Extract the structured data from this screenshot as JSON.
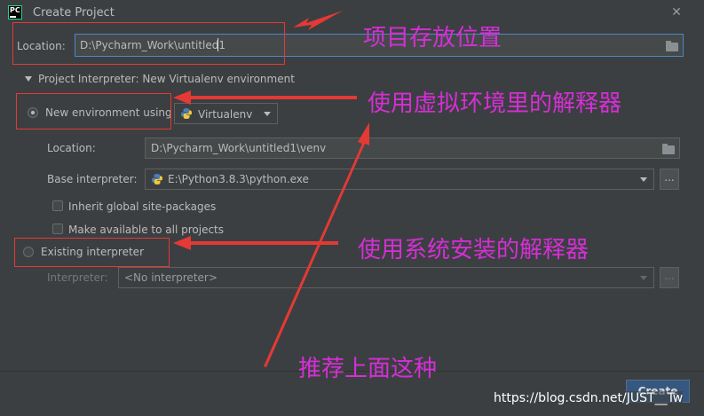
{
  "window": {
    "title": "Create Project"
  },
  "location": {
    "label": "Location:",
    "value": "D:\\Pycharm_Work\\untitled1"
  },
  "section": {
    "title": "Project Interpreter: New Virtualenv environment"
  },
  "new_env": {
    "radio_label": "New environment using",
    "tool": "Virtualenv",
    "location_label": "Location:",
    "location_value": "D:\\Pycharm_Work\\untitled1\\venv",
    "base_label": "Base interpreter:",
    "base_value": "E:\\Python3.8.3\\python.exe",
    "browse_label": "...",
    "inherit_label": "Inherit global site-packages",
    "make_available_label": "Make available to all projects"
  },
  "existing": {
    "radio_label": "Existing interpreter",
    "interpreter_label": "Interpreter:",
    "interpreter_value": "<No interpreter>",
    "browse_label": "..."
  },
  "buttons": {
    "create": "Create"
  },
  "annotations": {
    "location_note": "项目存放位置",
    "venv_note": "使用虚拟环境里的解释器",
    "system_note": "使用系统安装的解释器",
    "recommend_note": "推荐上面这种"
  },
  "watermark": "https://blog.csdn.net/JUST__Tw",
  "colors": {
    "annotation": "#d62ed6",
    "arrow": "#e53935",
    "focus": "#4a88c7",
    "primary_button": "#365880"
  }
}
